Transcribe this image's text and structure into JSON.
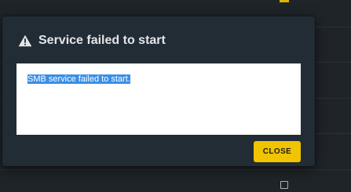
{
  "dialog": {
    "title": "Service failed to start",
    "icon": "warning-icon",
    "message": "SMB service failed to start.",
    "close_label": "CLOSE"
  },
  "colors": {
    "dialog_background": "#222c35",
    "accent": "#f0c400",
    "selection": "#3a8ee6",
    "page_background": "#1f2428"
  }
}
